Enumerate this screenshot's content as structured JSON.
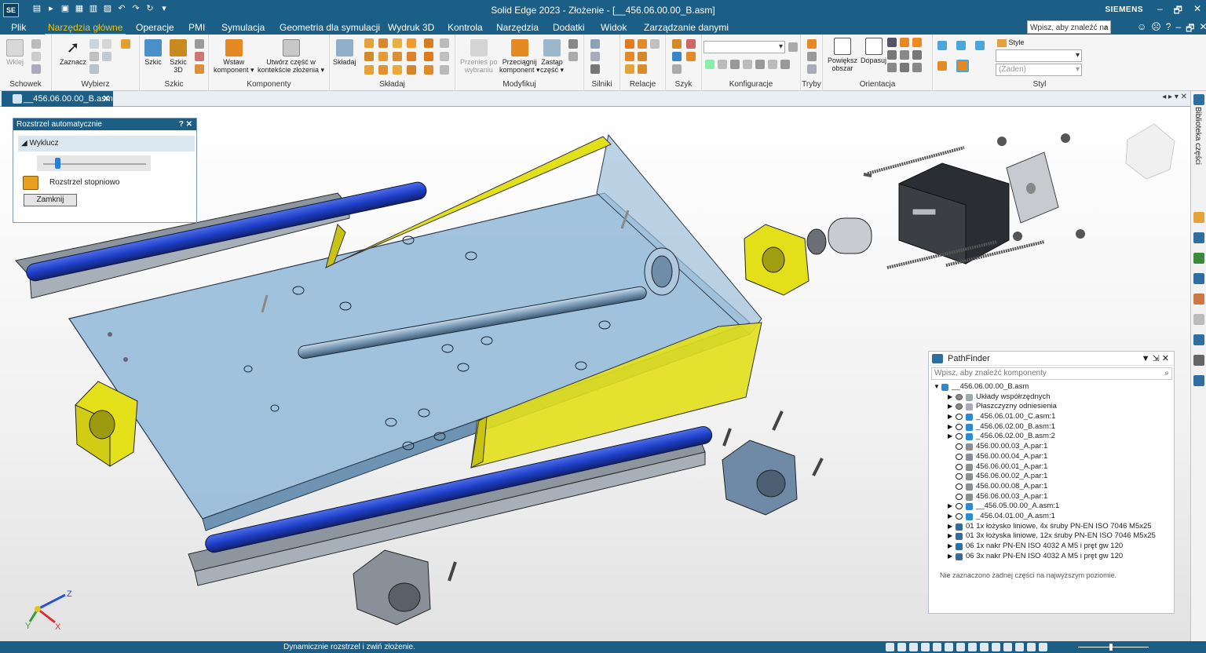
{
  "titlebar": {
    "logo": "SE",
    "title": "Solid Edge 2023 - Złożenie - [__456.06.00.00_B.asm]",
    "brand": "SIEMENS",
    "min": "–",
    "restore": "🗗",
    "close": "✕"
  },
  "menu": {
    "tabs": [
      "Plik",
      "Narzędzia główne",
      "Operacje",
      "PMI",
      "Symulacja",
      "Geometria dla symulacji",
      "Wydruk 3D",
      "Kontrola",
      "Narzędzia",
      "Dodatki",
      "Widok",
      "Zarządzanie danymi"
    ],
    "active_index": 1,
    "search_placeholder": "Wpisz, aby znaleźć na",
    "help": "?"
  },
  "ribbon": {
    "groups": {
      "schowek": "Schowek",
      "wybierz": "Wybierz",
      "szkic": "Szkic",
      "komponenty": "Komponenty",
      "skladaj": "Składaj",
      "modyfikuj": "Modyfikuj",
      "silniki": "Silniki",
      "relacje": "Relacje",
      "szyk": "Szyk",
      "konfiguracje": "Konfiguracje",
      "tryby": "Tryby",
      "orientacja": "Orientacja",
      "styl": "Styl"
    },
    "buttons": {
      "wklej": "Wklej",
      "zaznacz": "Zaznacz",
      "szkic": "Szkic",
      "szkic3d_1": "Szkic",
      "szkic3d_2": "3D",
      "wstaw_1": "Wstaw",
      "wstaw_2": "komponent ▾",
      "utworz_1": "Utwórz część w",
      "utworz_2": "kontekście złożenia ▾",
      "skladaj": "Składaj",
      "przenies_1": "Przenieś po",
      "przenies_2": "wybraniu",
      "przeciagnij_1": "Przeciągnij",
      "przeciagnij_2": "komponent ▾",
      "zastap_1": "Zastąp",
      "zastap_2": "część ▾",
      "powieksz_1": "Powiększ",
      "powieksz_2": "obszar",
      "dopasuj": "Dopasuj",
      "style": "Style",
      "styl_value": "(Żaden)"
    }
  },
  "document": {
    "tab_label": "__456.06.00.00_B.asm",
    "close": "✕",
    "nav": "◂ ▸ ▾ ✕"
  },
  "right_dock": {
    "label": "Biblioteka części"
  },
  "explode_panel": {
    "title": "Rozstrzel automatycznie",
    "controls": "? ✕",
    "section": "◢ Wyklucz",
    "slider_value": 0.12,
    "step_label": "Rozstrzel stopniowo",
    "close_button": "Zamknij"
  },
  "pathfinder": {
    "title": "PathFinder",
    "controls": "▼ ⇲ ✕",
    "filter_placeholder": "Wpisz, aby znaleźć komponenty",
    "tree": [
      {
        "level": 0,
        "expander": "▼",
        "eye": false,
        "icon": "assembly",
        "label": "__456.06.00.00_B.asm"
      },
      {
        "level": 1,
        "expander": "▶",
        "eye": "hidden",
        "icon": "coords",
        "label": "Układy współrzędnych"
      },
      {
        "level": 1,
        "expander": "▶",
        "eye": "hidden",
        "icon": "planes",
        "label": "Płaszczyzny odniesienia"
      },
      {
        "level": 1,
        "expander": "▶",
        "eye": true,
        "icon": "assembly",
        "label": "_456.06.01.00_C.asm:1"
      },
      {
        "level": 1,
        "expander": "▶",
        "eye": true,
        "icon": "assembly",
        "label": "_456.06.02.00_B.asm:1"
      },
      {
        "level": 1,
        "expander": "▶",
        "eye": true,
        "icon": "assembly",
        "label": "_456.06.02.00_B.asm:2"
      },
      {
        "level": 1,
        "expander": "",
        "eye": true,
        "icon": "part",
        "label": "456.00.00.03_A.par:1"
      },
      {
        "level": 1,
        "expander": "",
        "eye": true,
        "icon": "part",
        "label": "456.00.00.04_A.par:1"
      },
      {
        "level": 1,
        "expander": "",
        "eye": true,
        "icon": "part",
        "label": "456.06.00.01_A.par:1"
      },
      {
        "level": 1,
        "expander": "",
        "eye": true,
        "icon": "part",
        "label": "456.06.00.02_A.par:1"
      },
      {
        "level": 1,
        "expander": "",
        "eye": true,
        "icon": "part",
        "label": "456.00.00.08_A.par:1"
      },
      {
        "level": 1,
        "expander": "",
        "eye": true,
        "icon": "part",
        "label": "456.06.00.03_A.par:1"
      },
      {
        "level": 1,
        "expander": "▶",
        "eye": true,
        "icon": "assembly",
        "label": "__456.05.00.00_A.asm:1"
      },
      {
        "level": 1,
        "expander": "▶",
        "eye": true,
        "icon": "assembly",
        "label": "_456.04.01.00_A.asm:1"
      },
      {
        "level": 1,
        "expander": "▶",
        "eye": false,
        "icon": "pattern",
        "label": "01  1x  łożysko liniowe,  4x  śruby PN-EN ISO 7046 M5x25"
      },
      {
        "level": 1,
        "expander": "▶",
        "eye": false,
        "icon": "pattern",
        "label": "01  3x  łożyska liniowe,  12x  śruby PN-EN ISO 7046 M5x25"
      },
      {
        "level": 1,
        "expander": "▶",
        "eye": false,
        "icon": "pattern",
        "label": "06  1x  nakr PN-EN ISO 4032 A M5 i pręt gw 120"
      },
      {
        "level": 1,
        "expander": "▶",
        "eye": false,
        "icon": "pattern",
        "label": "06  3x  nakr PN-EN ISO 4032 A M5 i pręt gw 120"
      }
    ],
    "status": "Nie zaznaczono żadnej części na najwyższym poziomie."
  },
  "triad": {
    "x": "X",
    "y": "Y",
    "z": "Z"
  },
  "status_bar": {
    "message": "Dynamicznie rozstrzel i zwiń złożenie."
  },
  "colors": {
    "accent": "#1b5e86",
    "active_tab": "#f3c200",
    "yellow_part": "#e3e01a",
    "blue_rod": "#1e3fc8",
    "plate": "#8fb6d6",
    "steel": "#9aa3ab"
  }
}
